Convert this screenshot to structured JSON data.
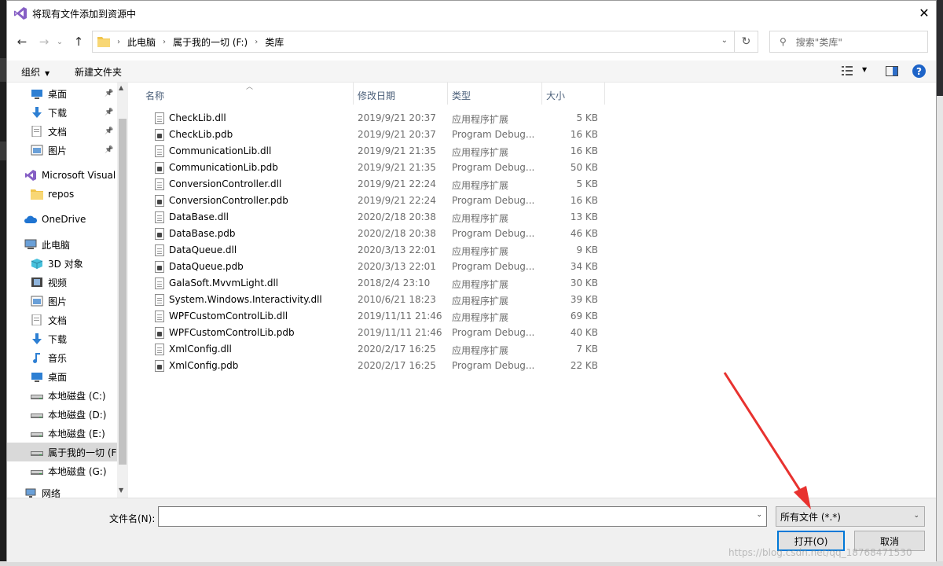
{
  "dialog": {
    "title": "将现有文件添加到资源中",
    "close_glyph": "✕"
  },
  "address": {
    "crumbs": [
      "此电脑",
      "属于我的一切 (F:)",
      "类库"
    ],
    "search_placeholder": "搜索\"类库\""
  },
  "toolbar": {
    "organize": "组织",
    "new_folder": "新建文件夹",
    "help": "?"
  },
  "nav": {
    "items": [
      {
        "label": "桌面",
        "icon": "desktop-icon",
        "pinned": true
      },
      {
        "label": "下载",
        "icon": "download-icon",
        "pinned": true
      },
      {
        "label": "文档",
        "icon": "document-icon",
        "pinned": true
      },
      {
        "label": "图片",
        "icon": "picture-icon",
        "pinned": true
      },
      {
        "label": "Microsoft Visual",
        "icon": "visual-studio-icon",
        "pinned": false
      },
      {
        "label": "repos",
        "icon": "folder-icon",
        "pinned": false
      },
      {
        "label": "OneDrive",
        "icon": "onedrive-icon",
        "pinned": false
      },
      {
        "label": "此电脑",
        "icon": "computer-icon",
        "pinned": false
      },
      {
        "label": "3D 对象",
        "icon": "3d-objects-icon",
        "pinned": false
      },
      {
        "label": "视频",
        "icon": "video-icon",
        "pinned": false
      },
      {
        "label": "图片",
        "icon": "picture-icon",
        "pinned": false
      },
      {
        "label": "文档",
        "icon": "document-icon",
        "pinned": false
      },
      {
        "label": "下载",
        "icon": "download-icon",
        "pinned": false
      },
      {
        "label": "音乐",
        "icon": "music-icon",
        "pinned": false
      },
      {
        "label": "桌面",
        "icon": "desktop-icon",
        "pinned": false
      },
      {
        "label": "本地磁盘 (C:)",
        "icon": "drive-icon",
        "pinned": false
      },
      {
        "label": "本地磁盘 (D:)",
        "icon": "drive-icon",
        "pinned": false
      },
      {
        "label": "本地磁盘 (E:)",
        "icon": "drive-icon",
        "pinned": false
      },
      {
        "label": "属于我的一切 (F",
        "icon": "drive-icon",
        "pinned": false,
        "selected": true
      },
      {
        "label": "本地磁盘 (G:)",
        "icon": "drive-icon",
        "pinned": false
      },
      {
        "label": "网络",
        "icon": "network-icon",
        "pinned": false
      }
    ]
  },
  "columns": {
    "name": "名称",
    "date": "修改日期",
    "type": "类型",
    "size": "大小"
  },
  "files": [
    {
      "name": "CheckLib.dll",
      "date": "2019/9/21 20:37",
      "type": "应用程序扩展",
      "size": "5 KB",
      "kind": "dll"
    },
    {
      "name": "CheckLib.pdb",
      "date": "2019/9/21 20:37",
      "type": "Program Debug...",
      "size": "16 KB",
      "kind": "pdb"
    },
    {
      "name": "CommunicationLib.dll",
      "date": "2019/9/21 21:35",
      "type": "应用程序扩展",
      "size": "16 KB",
      "kind": "dll"
    },
    {
      "name": "CommunicationLib.pdb",
      "date": "2019/9/21 21:35",
      "type": "Program Debug...",
      "size": "50 KB",
      "kind": "pdb"
    },
    {
      "name": "ConversionController.dll",
      "date": "2019/9/21 22:24",
      "type": "应用程序扩展",
      "size": "5 KB",
      "kind": "dll"
    },
    {
      "name": "ConversionController.pdb",
      "date": "2019/9/21 22:24",
      "type": "Program Debug...",
      "size": "16 KB",
      "kind": "pdb"
    },
    {
      "name": "DataBase.dll",
      "date": "2020/2/18 20:38",
      "type": "应用程序扩展",
      "size": "13 KB",
      "kind": "dll"
    },
    {
      "name": "DataBase.pdb",
      "date": "2020/2/18 20:38",
      "type": "Program Debug...",
      "size": "46 KB",
      "kind": "pdb"
    },
    {
      "name": "DataQueue.dll",
      "date": "2020/3/13 22:01",
      "type": "应用程序扩展",
      "size": "9 KB",
      "kind": "dll"
    },
    {
      "name": "DataQueue.pdb",
      "date": "2020/3/13 22:01",
      "type": "Program Debug...",
      "size": "34 KB",
      "kind": "pdb"
    },
    {
      "name": "GalaSoft.MvvmLight.dll",
      "date": "2018/2/4 23:10",
      "type": "应用程序扩展",
      "size": "30 KB",
      "kind": "dll"
    },
    {
      "name": "System.Windows.Interactivity.dll",
      "date": "2010/6/21 18:23",
      "type": "应用程序扩展",
      "size": "39 KB",
      "kind": "dll"
    },
    {
      "name": "WPFCustomControlLib.dll",
      "date": "2019/11/11 21:46",
      "type": "应用程序扩展",
      "size": "69 KB",
      "kind": "dll"
    },
    {
      "name": "WPFCustomControlLib.pdb",
      "date": "2019/11/11 21:46",
      "type": "Program Debug...",
      "size": "40 KB",
      "kind": "pdb"
    },
    {
      "name": "XmlConfig.dll",
      "date": "2020/2/17 16:25",
      "type": "应用程序扩展",
      "size": "7 KB",
      "kind": "dll"
    },
    {
      "name": "XmlConfig.pdb",
      "date": "2020/2/17 16:25",
      "type": "Program Debug...",
      "size": "22 KB",
      "kind": "pdb"
    }
  ],
  "footer": {
    "filename_label": "文件名(N):",
    "filename_value": "",
    "filter_value": "所有文件 (*.*)",
    "open_label": "打开(O)",
    "cancel_label": "取消",
    "watermark": "https://blog.csdn.net/qq_18768471530"
  },
  "colors": {
    "accent": "#0078d7",
    "annotation_arrow": "#e8322f"
  }
}
